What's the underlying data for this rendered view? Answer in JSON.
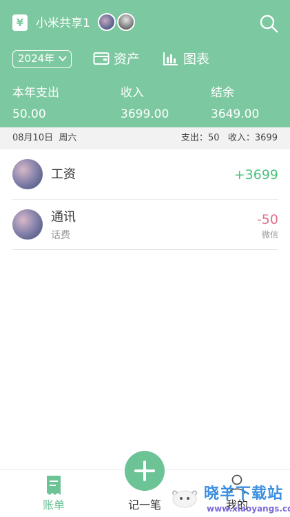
{
  "header": {
    "book_name": "小米共享1",
    "year": "2024年",
    "assets_label": "资产",
    "charts_label": "图表",
    "icons": [
      "book-icon",
      "search-icon",
      "wallet-icon",
      "bar-chart-icon",
      "chevron-down-icon"
    ],
    "accent_color": "#7cc8a0"
  },
  "summary": {
    "expense_label": "本年支出",
    "expense_value": "50.00",
    "income_label": "收入",
    "income_value": "3699.00",
    "balance_label": "结余",
    "balance_value": "3649.00"
  },
  "day": {
    "date": "08月10日",
    "weekday": "周六",
    "expense_label": "支出：",
    "expense_value": "50",
    "income_label": "收入：",
    "income_value": "3699"
  },
  "records": [
    {
      "title": "工资",
      "amount": "+3699",
      "type": "income"
    },
    {
      "title": "通讯",
      "subtitle": "话费",
      "amount": "-50",
      "payment": "微信",
      "type": "expense"
    }
  ],
  "tabbar": {
    "bills_label": "账单",
    "add_label": "记一笔",
    "mine_label": "我的",
    "active_color": "#6cc396"
  },
  "watermark": {
    "title": "晓羊下载站",
    "url": "www.xiaoyangs.com"
  }
}
